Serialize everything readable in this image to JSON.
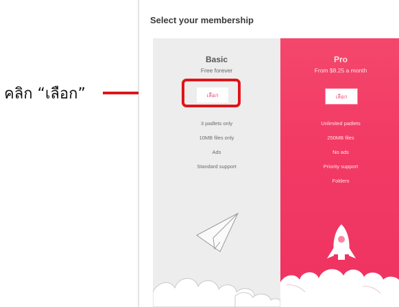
{
  "annotation": {
    "label": "คลิก “เลือก”",
    "color": "#e0141a"
  },
  "dialog": {
    "title": "Select your membership"
  },
  "plans": {
    "basic": {
      "name": "Basic",
      "subtitle": "Free forever",
      "button_label": "เลือก",
      "features": [
        "3 padlets only",
        "10MB files only",
        "Ads",
        "Standard support"
      ],
      "illustration": "paper-plane-icon"
    },
    "pro": {
      "name": "Pro",
      "subtitle": "From $8.25 a month",
      "button_label": "เลือก",
      "features": [
        "Unlimited padlets",
        "250MB files",
        "No ads",
        "Priority support",
        "Folders"
      ],
      "illustration": "rocket-icon",
      "accent_color": "#f23a64"
    }
  }
}
